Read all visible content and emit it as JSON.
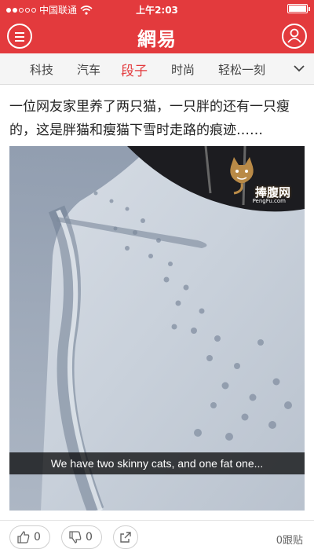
{
  "status_bar": {
    "carrier": "中国联通",
    "time": "上午2:03"
  },
  "header": {
    "logo": "網易",
    "menu_icon": "hamburger-menu-icon",
    "user_icon": "user-profile-icon",
    "color": "#e33a3d"
  },
  "tabs": [
    {
      "label": "科技",
      "active": false
    },
    {
      "label": "汽车",
      "active": false
    },
    {
      "label": "段子",
      "active": true
    },
    {
      "label": "时尚",
      "active": false
    },
    {
      "label": "轻松一刻",
      "active": false
    }
  ],
  "article": {
    "headline": "一位网友家里养了两只猫，一只胖的还有一只瘦的，这是胖猫和瘦猫下雪时走路的痕迹……",
    "caption": "We have two skinny cats, and one fat one...",
    "watermark": "捧腹网",
    "watermark_sub": "PengFu.com"
  },
  "actions": {
    "like_count": "0",
    "dislike_count": "0",
    "comment_count": "0跟贴"
  }
}
